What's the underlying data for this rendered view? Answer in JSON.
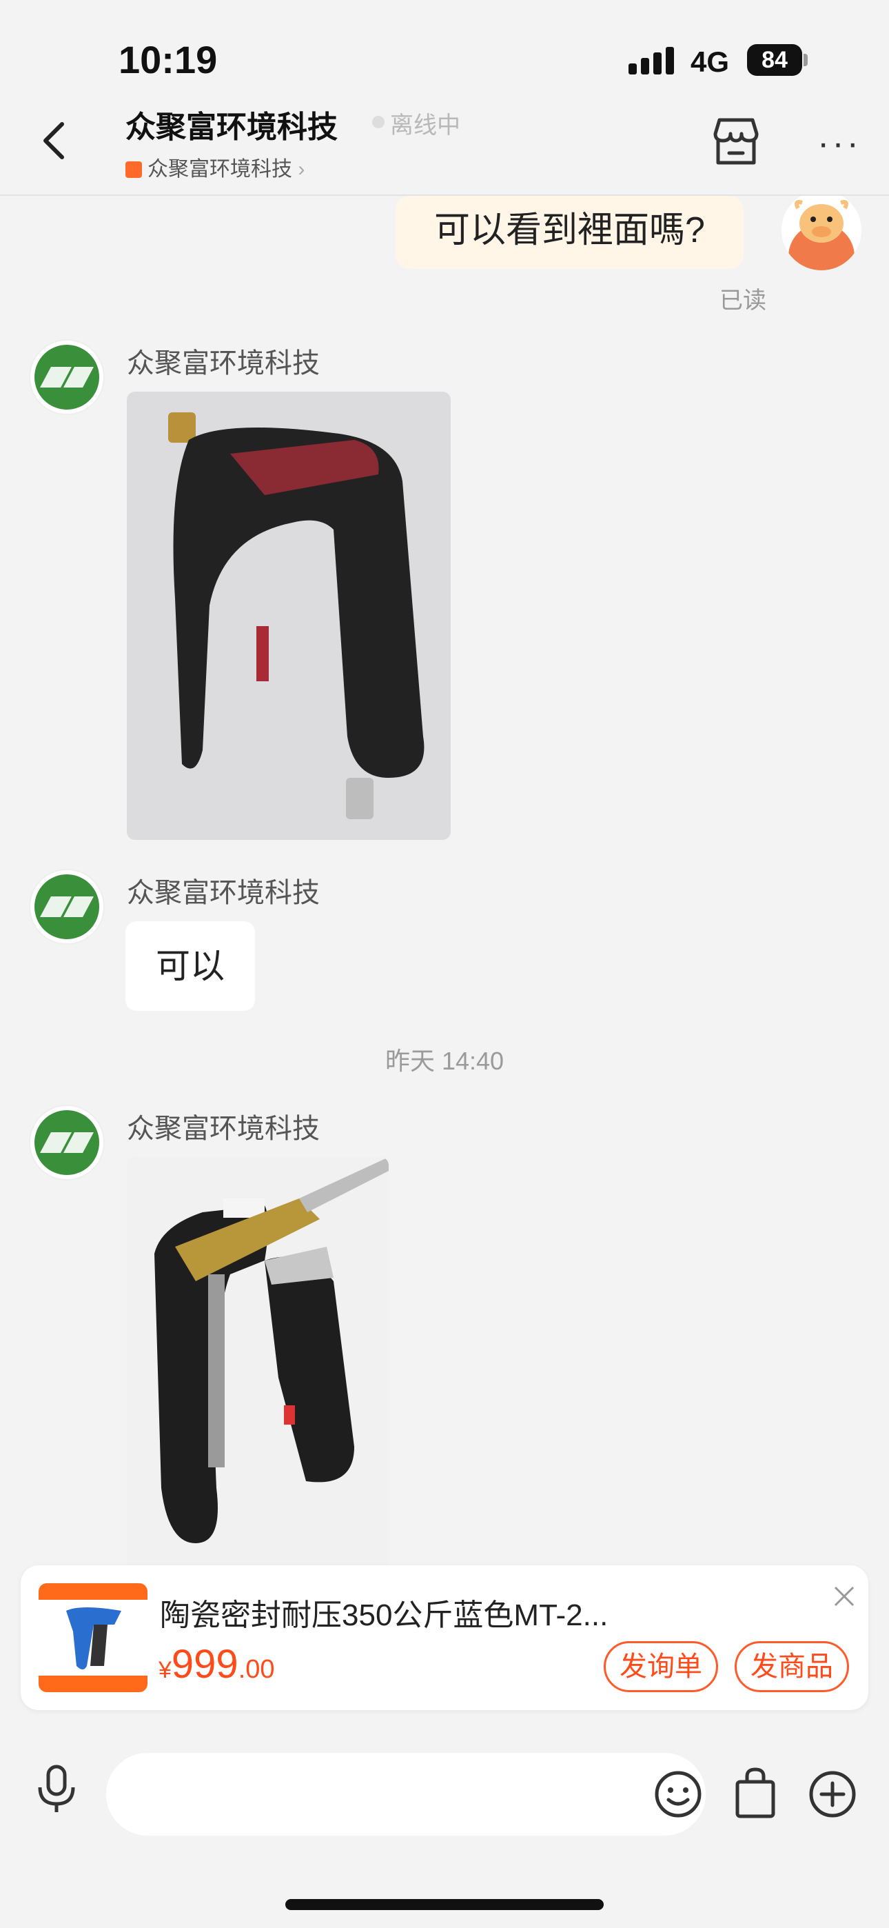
{
  "status_bar": {
    "time": "10:19",
    "network": "4G",
    "battery": "84"
  },
  "header": {
    "shop_name": "众聚富环境科技",
    "status": "离线中",
    "sub_shop": "众聚富环境科技",
    "sub_chevron": "›",
    "more": "···"
  },
  "chat": {
    "self_message": "可以看到裡面嗎?",
    "read_status": "已读",
    "messages": [
      {
        "sender": "众聚富环境科技"
      },
      {
        "sender": "众聚富环境科技",
        "text": "可以"
      },
      {
        "sender": "众聚富环境科技"
      }
    ],
    "timestamp": "昨天 14:40"
  },
  "product": {
    "title": "陶瓷密封耐压350公斤蓝色MT-2...",
    "price_currency": "¥",
    "price_int": "999",
    "price_dec": ".00",
    "inquiry_button": "发询单",
    "send_product_button": "发商品"
  },
  "input": {
    "placeholder": ""
  },
  "colors": {
    "accent": "#ff4a1a",
    "self_bubble": "#fff6e8",
    "background": "#f3f3f3"
  }
}
